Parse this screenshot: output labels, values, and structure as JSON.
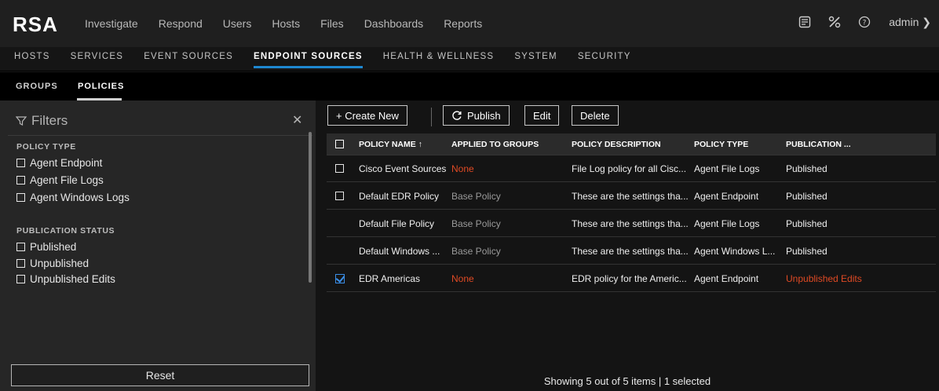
{
  "logo": "RSA",
  "nav": [
    "Investigate",
    "Respond",
    "Users",
    "Hosts",
    "Files",
    "Dashboards",
    "Reports"
  ],
  "topbar": {
    "admin": "admin ❯",
    "icons": [
      "notes-icon",
      "tools-icon",
      "help-icon"
    ]
  },
  "subnav": [
    "HOSTS",
    "SERVICES",
    "EVENT SOURCES",
    "ENDPOINT SOURCES",
    "HEALTH & WELLNESS",
    "SYSTEM",
    "SECURITY"
  ],
  "subnav_active": "ENDPOINT SOURCES",
  "tabs": [
    "GROUPS",
    "POLICIES"
  ],
  "tabs_active": "POLICIES",
  "filters": {
    "title": "Filters",
    "policy_type_heading": "POLICY TYPE",
    "policy_types": [
      "Agent Endpoint",
      "Agent File Logs",
      "Agent Windows Logs"
    ],
    "publication_heading": "PUBLICATION STATUS",
    "publication_statuses": [
      "Published",
      "Unpublished",
      "Unpublished Edits"
    ],
    "reset": "Reset"
  },
  "toolbar": {
    "create": "+ Create New",
    "publish": "Publish",
    "edit": "Edit",
    "delete": "Delete"
  },
  "table": {
    "headers": [
      "POLICY NAME ↑",
      "APPLIED TO GROUPS",
      "POLICY DESCRIPTION",
      "POLICY TYPE",
      "PUBLICATION ..."
    ],
    "rows": [
      {
        "name": "Cisco Event Sources",
        "groups": "None",
        "desc": "File Log policy for all Cisc...",
        "type": "Agent File Logs",
        "status": "Published"
      },
      {
        "name": "Default EDR Policy",
        "groups": "Base Policy",
        "desc": "These are the settings tha...",
        "type": "Agent Endpoint",
        "status": "Published"
      },
      {
        "name": "Default File Policy",
        "groups": "Base Policy",
        "desc": "These are the settings tha...",
        "type": "Agent File Logs",
        "status": "Published"
      },
      {
        "name": "Default Windows ...",
        "groups": "Base Policy",
        "desc": "These are the settings tha...",
        "type": "Agent Windows L...",
        "status": "Published"
      },
      {
        "name": "EDR Americas",
        "groups": "None",
        "desc": "EDR policy for the Americ...",
        "type": "Agent Endpoint",
        "status": "Unpublished Edits"
      }
    ]
  },
  "footer": "Showing 5 out of 5 items  |  1 selected",
  "colors": {
    "accent": "#1e88d0",
    "warn": "#e04a24"
  }
}
